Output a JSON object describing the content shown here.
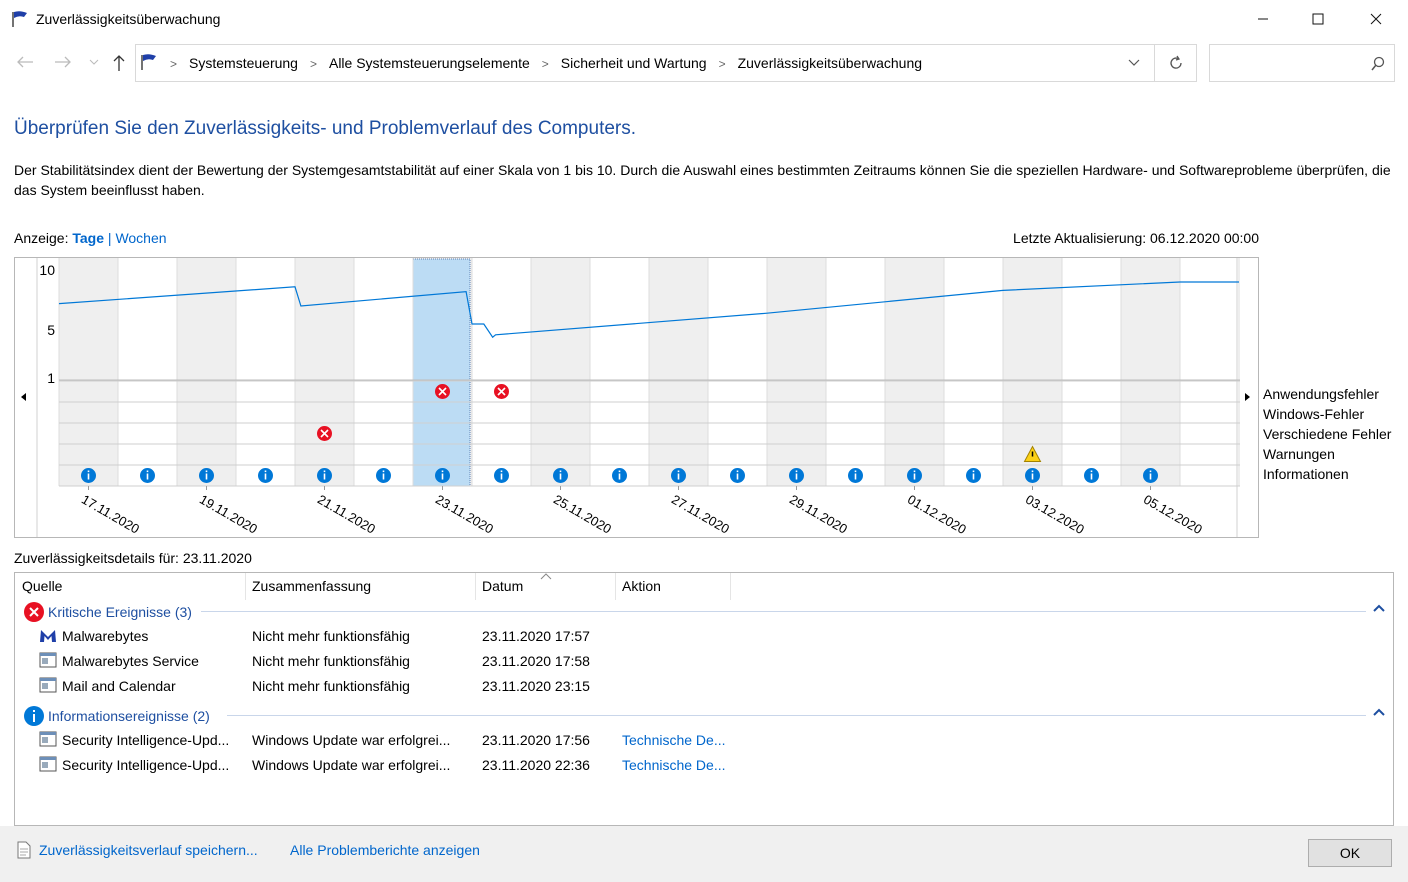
{
  "window": {
    "title": "Zuverlässigkeitsüberwachung"
  },
  "address": {
    "breadcrumbs": [
      "Systemsteuerung",
      "Alle Systemsteuerungselemente",
      "Sicherheit und Wartung",
      "Zuverlässigkeitsüberwachung"
    ],
    "search_placeholder": ""
  },
  "heading": "Überprüfen Sie den Zuverlässigkeits- und Problemverlauf des Computers.",
  "description": "Der Stabilitätsindex dient der Bewertung der Systemgesamtstabilität auf einer Skala von 1 bis 10. Durch die Auswahl eines bestimmten Zeitraums können Sie die speziellen Hardware- und Softwareprobleme überprüfen, die das System beeinflusst haben.",
  "view": {
    "label": "Anzeige:",
    "days": "Tage",
    "sep": "|",
    "weeks": "Wochen",
    "selected": "days"
  },
  "last_update": "Letzte Aktualisierung: 06.12.2020 00:00",
  "chart_data": {
    "type": "line",
    "yticks": [
      "10",
      "5",
      "1"
    ],
    "ylim": [
      1,
      10
    ],
    "x": [
      "16.11.2020",
      "17.11.2020",
      "18.11.2020",
      "19.11.2020",
      "20.11.2020",
      "21.11.2020",
      "22.11.2020",
      "23.11.2020",
      "24.11.2020",
      "25.11.2020",
      "26.11.2020",
      "27.11.2020",
      "28.11.2020",
      "29.11.2020",
      "30.11.2020",
      "01.12.2020",
      "02.12.2020",
      "03.12.2020",
      "04.12.2020",
      "05.12.2020",
      "06.12.2020"
    ],
    "xtick_labels": [
      "17.11.2020",
      "19.11.2020",
      "21.11.2020",
      "23.11.2020",
      "25.11.2020",
      "27.11.2020",
      "29.11.2020",
      "01.12.2020",
      "03.12.2020",
      "05.12.2020"
    ],
    "stability_points": [
      {
        "day": 0.0,
        "v": 7.2
      },
      {
        "day": 4.0,
        "v": 8.6
      },
      {
        "day": 4.1,
        "v": 7.0
      },
      {
        "day": 6.9,
        "v": 8.2
      },
      {
        "day": 7.0,
        "v": 5.5
      },
      {
        "day": 7.2,
        "v": 5.5
      },
      {
        "day": 7.35,
        "v": 4.4
      },
      {
        "day": 7.4,
        "v": 4.6
      },
      {
        "day": 12.0,
        "v": 6.4
      },
      {
        "day": 16.0,
        "v": 8.3
      },
      {
        "day": 19.0,
        "v": 9.0
      },
      {
        "day": 20.0,
        "v": 9.0
      }
    ],
    "selected_day": "23.11.2020",
    "event_rows": [
      "Anwendungsfehler",
      "Windows-Fehler",
      "Verschiedene Fehler",
      "Warnungen",
      "Informationen"
    ],
    "events": [
      {
        "row": "Anwendungsfehler",
        "days": [
          "23.11.2020",
          "24.11.2020"
        ],
        "kind": "error"
      },
      {
        "row": "Verschiedene Fehler",
        "days": [
          "21.11.2020"
        ],
        "kind": "error"
      },
      {
        "row": "Warnungen",
        "days": [
          "03.12.2020"
        ],
        "kind": "warning"
      },
      {
        "row": "Informationen",
        "days": [
          "17.11.2020",
          "18.11.2020",
          "19.11.2020",
          "20.11.2020",
          "21.11.2020",
          "22.11.2020",
          "23.11.2020",
          "24.11.2020",
          "25.11.2020",
          "26.11.2020",
          "27.11.2020",
          "28.11.2020",
          "29.11.2020",
          "30.11.2020",
          "01.12.2020",
          "02.12.2020",
          "03.12.2020",
          "04.12.2020",
          "05.12.2020"
        ],
        "kind": "info"
      }
    ]
  },
  "details": {
    "title": "Zuverlässigkeitsdetails für: 23.11.2020",
    "columns": [
      "Quelle",
      "Zusammenfassung",
      "Datum",
      "Aktion"
    ],
    "groups": [
      {
        "label": "Kritische Ereignisse (3)",
        "rows": [
          {
            "source": "Malwarebytes",
            "summary": "Nicht mehr funktionsfähig",
            "date": "23.11.2020 17:57",
            "action": ""
          },
          {
            "source": "Malwarebytes Service",
            "summary": "Nicht mehr funktionsfähig",
            "date": "23.11.2020 17:58",
            "action": ""
          },
          {
            "source": "Mail and Calendar",
            "summary": "Nicht mehr funktionsfähig",
            "date": "23.11.2020 23:15",
            "action": ""
          }
        ]
      },
      {
        "label": "Informationsereignisse (2)",
        "rows": [
          {
            "source": "Security Intelligence-Upd...",
            "summary": "Windows Update war erfolgrei...",
            "date": "23.11.2020 17:56",
            "action": "Technische De..."
          },
          {
            "source": "Security Intelligence-Upd...",
            "summary": "Windows Update war erfolgrei...",
            "date": "23.11.2020 22:36",
            "action": "Technische De..."
          }
        ]
      }
    ]
  },
  "footer": {
    "save_link": "Zuverlässigkeitsverlauf speichern...",
    "reports_link": "Alle Problemberichte anzeigen",
    "ok": "OK"
  },
  "colors": {
    "accent": "#0078d7",
    "heading": "#1e4fa1",
    "error": "#e81123",
    "warning": "#fcd116",
    "selected": "#bcdcf4"
  }
}
